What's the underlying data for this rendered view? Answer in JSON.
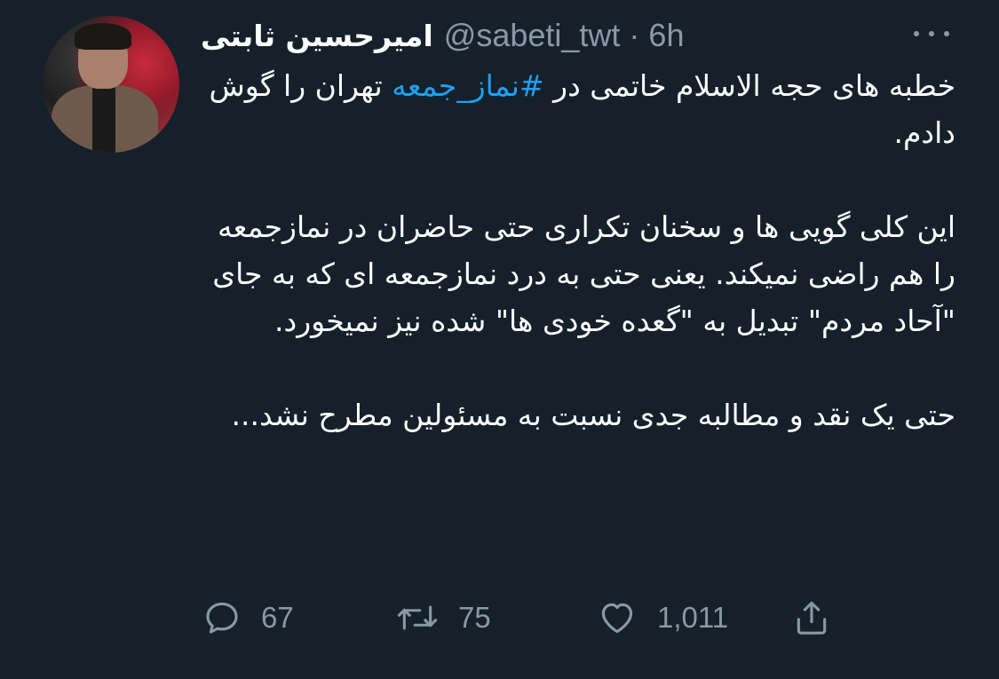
{
  "tweet": {
    "display_name": "امیرحسین ثابتی",
    "meta": "@sabeti_twt · 6h",
    "paragraph1_before": "خطبه های حجه الاسلام خاتمی در ",
    "hashtag": "#نماز_جمعه",
    "paragraph1_after": " تهران را گوش دادم.",
    "paragraph2": "این کلی گویی ها و سخنان تکراری حتی حاضران در نمازجمعه را هم راضی نمیکند. یعنی حتی به درد نمازجمعه ای که به جای \"آحاد مردم\" تبدیل به \"گعده خودی ها\" شده نیز نمیخورد.",
    "paragraph3": "حتی یک نقد و مطالبه جدی نسبت به مسئولین مطرح نشد..."
  },
  "actions": {
    "reply_count": "67",
    "retweet_count": "75",
    "like_count": "1,011"
  },
  "icons": {
    "more": "more-icon",
    "reply": "reply-icon",
    "retweet": "retweet-icon",
    "like": "heart-icon",
    "share": "share-icon"
  },
  "colors": {
    "background": "#15202b",
    "text": "#ffffff",
    "secondary": "#8899a6",
    "accent": "#1da1f2"
  }
}
